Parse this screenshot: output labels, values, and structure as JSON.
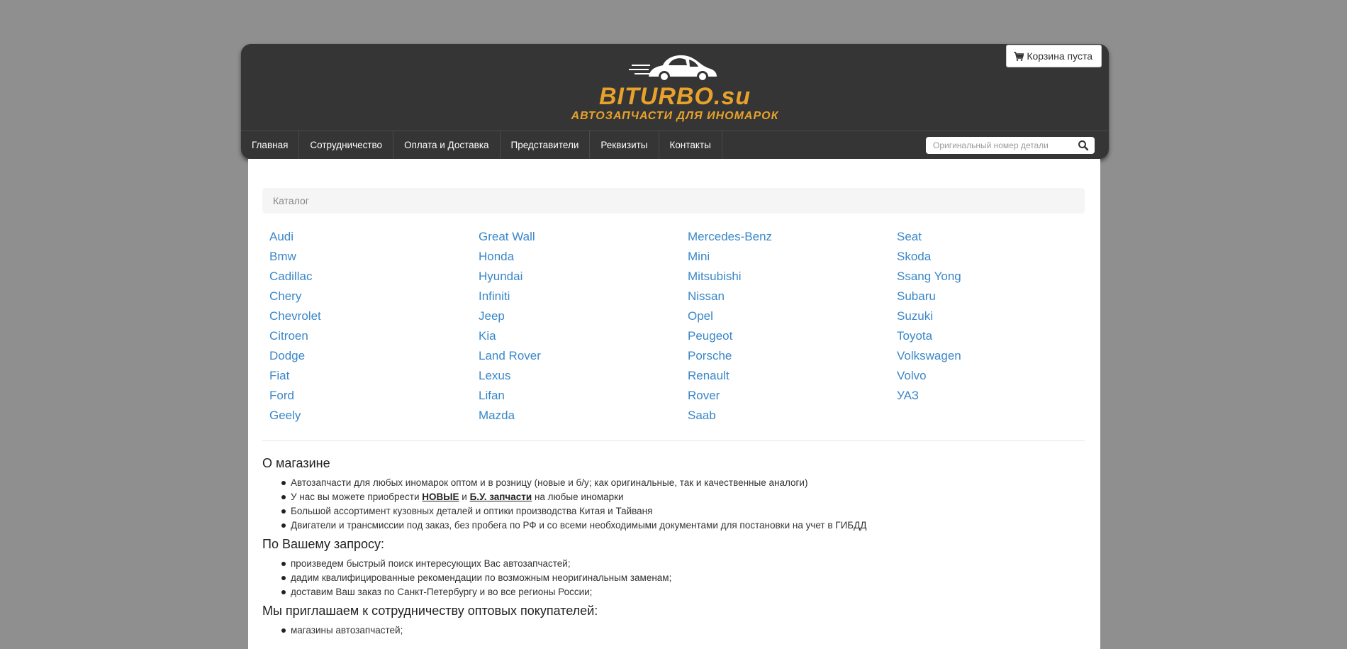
{
  "header": {
    "logo_title": "BITURBO.su",
    "logo_subtitle": "АВТОЗАПЧАСТИ ДЛЯ ИНОМАРОК",
    "cart_label": "Корзина пуста",
    "cart_icon": "shopping-cart-icon",
    "brand_color": "#e8a22b"
  },
  "nav": {
    "items": [
      "Главная",
      "Сотрудничество",
      "Оплата и Доставка",
      "Представители",
      "Реквизиты",
      "Контакты"
    ]
  },
  "search": {
    "placeholder": "Оригинальный номер детали",
    "icon": "search-icon"
  },
  "breadcrumb": "Каталог",
  "brands": [
    "Audi",
    "Bmw",
    "Cadillac",
    "Chery",
    "Chevrolet",
    "Citroen",
    "Dodge",
    "Fiat",
    "Ford",
    "Geely",
    "Great Wall",
    "Honda",
    "Hyundai",
    "Infiniti",
    "Jeep",
    "Kia",
    "Land Rover",
    "Lexus",
    "Lifan",
    "Mazda",
    "Mercedes-Benz",
    "Mini",
    "Mitsubishi",
    "Nissan",
    "Opel",
    "Peugeot",
    "Porsche",
    "Renault",
    "Rover",
    "Saab",
    "Seat",
    "Skoda",
    "Ssang Yong",
    "Subaru",
    "Suzuki",
    "Toyota",
    "Volkswagen",
    "Volvo",
    "УАЗ"
  ],
  "about": {
    "title": "О магазине",
    "items": [
      "Автозапчасти для любых иномарок оптом и в розницу (новые и б/у; как оригинальные, так и качественные аналоги)",
      "Большой ассортимент кузовных деталей и оптики производства Китая и Тайваня",
      "Двигатели и трансмиссии под заказ, без пробега по РФ и со всеми необходимыми документами для постановки на учет в ГИБДД"
    ],
    "offer": {
      "prefix": "У нас вы можете приобрести ",
      "link_new": "НОВЫЕ",
      "middle": " и ",
      "link_used": "Б.У. запчасти",
      "suffix": " на любые иномарки"
    }
  },
  "request": {
    "title": "По Вашему запросу:",
    "items": [
      "произведем быстрый поиск интересующих Вас автозапчастей;",
      "дадим квалифицированные рекомендации по возможным неоригинальным заменам;",
      "доставим Ваш заказ по Санкт-Петербургу и во все регионы России;"
    ]
  },
  "wholesale": {
    "title": "Мы приглашаем к сотрудничеству оптовых покупателей:",
    "items": [
      "магазины автозапчастей;"
    ]
  }
}
